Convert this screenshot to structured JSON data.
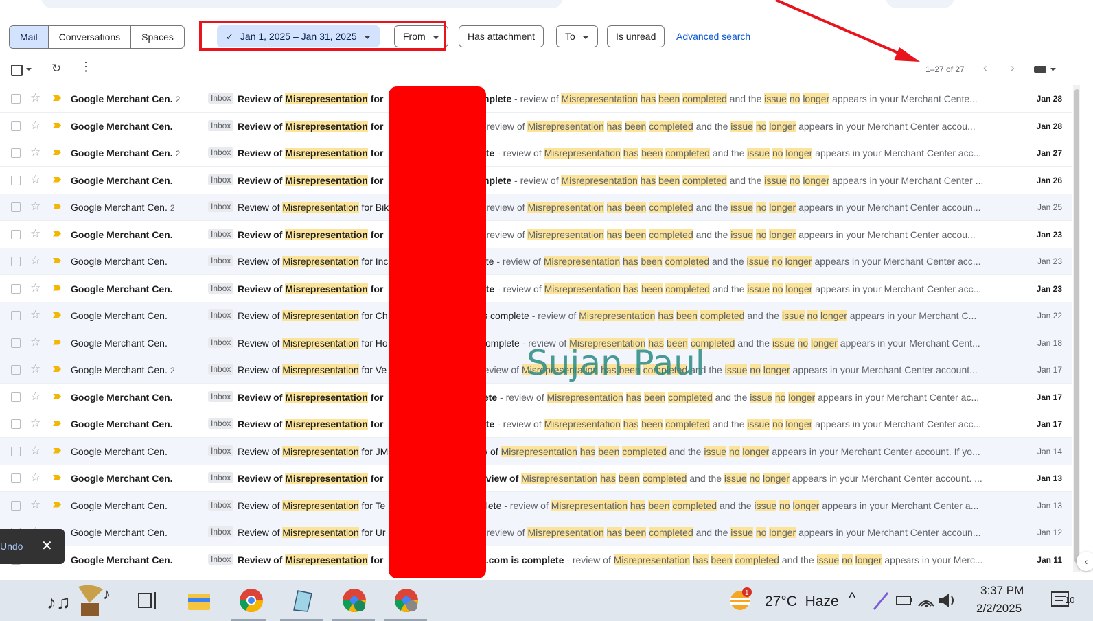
{
  "mode_tabs": [
    "Mail",
    "Conversations",
    "Spaces"
  ],
  "filters": {
    "date_range": "Jan 1, 2025 – Jan 31, 2025",
    "from": "From",
    "has_attachment": "Has attachment",
    "to": "To",
    "is_unread": "Is unread",
    "advanced_search": "Advanced search"
  },
  "pagination": {
    "count": "1–27 of 27"
  },
  "watermark": "Sujan Paul",
  "snackbar": {
    "undo": "Undo"
  },
  "highlight_terms": [
    "Misrepresentation",
    "has",
    "been",
    "completed",
    "issue",
    "no",
    "longer"
  ],
  "rows": [
    {
      "sender": "Google Merchant Cen.",
      "thread": "2",
      "tag": "Inbox",
      "subject": "Review of Misrepresentation for",
      "rest": "mplete",
      "snippet": " - review of Misrepresentation has been completed and the issue no longer appears in your Merchant Cente...",
      "date": "Jan 28",
      "unread": true
    },
    {
      "sender": "Google Merchant Cen.",
      "thread": "",
      "tag": "Inbox",
      "subject": "Review of Misrepresentation for",
      "rest": "",
      "snippet": " - review of Misrepresentation has been completed and the issue no longer appears in your Merchant Center accou...",
      "date": "Jan 28",
      "unread": true
    },
    {
      "sender": "Google Merchant Cen.",
      "thread": "2",
      "tag": "Inbox",
      "subject": "Review of Misrepresentation for",
      "rest": "ete",
      "snippet": " - review of Misrepresentation has been completed and the issue no longer appears in your Merchant Center acc...",
      "date": "Jan 27",
      "unread": true
    },
    {
      "sender": "Google Merchant Cen.",
      "thread": "",
      "tag": "Inbox",
      "subject": "Review of Misrepresentation for",
      "rest": "mplete",
      "snippet": " - review of Misrepresentation has been completed and the issue no longer appears in your Merchant Center ...",
      "date": "Jan 26",
      "unread": true
    },
    {
      "sender": "Google Merchant Cen.",
      "thread": "2",
      "tag": "Inbox",
      "subject": "Review of Misrepresentation for Bik",
      "rest": "",
      "snippet": " - review of Misrepresentation has been completed and the issue no longer appears in your Merchant Center accoun...",
      "date": "Jan 25",
      "unread": false
    },
    {
      "sender": "Google Merchant Cen.",
      "thread": "",
      "tag": "Inbox",
      "subject": "Review of Misrepresentation for",
      "rest": "",
      "snippet": " - review of Misrepresentation has been completed and the issue no longer appears in your Merchant Center accou...",
      "date": "Jan 23",
      "unread": true
    },
    {
      "sender": "Google Merchant Cen.",
      "thread": "",
      "tag": "Inbox",
      "subject": "Review of Misrepresentation for Inc",
      "rest": "ete",
      "snippet": " - review of Misrepresentation has been completed and the issue no longer appears in your Merchant Center acc...",
      "date": "Jan 23",
      "unread": false
    },
    {
      "sender": "Google Merchant Cen.",
      "thread": "",
      "tag": "Inbox",
      "subject": "Review of Misrepresentation for",
      "rest": "ete",
      "snippet": " - review of Misrepresentation has been completed and the issue no longer appears in your Merchant Center acc...",
      "date": "Jan 23",
      "unread": true
    },
    {
      "sender": "Google Merchant Cen.",
      "thread": "",
      "tag": "Inbox",
      "subject": "Review of Misrepresentation for Ch",
      "rest": "is complete",
      "snippet": " - review of Misrepresentation has been completed and the issue no longer appears in your Merchant C...",
      "date": "Jan 22",
      "unread": false
    },
    {
      "sender": "Google Merchant Cen.",
      "thread": "",
      "tag": "Inbox",
      "subject": "Review of Misrepresentation for Ho",
      "rest": "complete",
      "snippet": " - review of Misrepresentation has been completed and the issue no longer appears in your Merchant Cent...",
      "date": "Jan 18",
      "unread": false
    },
    {
      "sender": "Google Merchant Cen.",
      "thread": "2",
      "tag": "Inbox",
      "subject": "Review of Misrepresentation for Ve",
      "rest": "",
      "snippet": "review of Misrepresentation has been completed and the issue no longer appears in your Merchant Center account...",
      "date": "Jan 17",
      "unread": false
    },
    {
      "sender": "Google Merchant Cen.",
      "thread": "",
      "tag": "Inbox",
      "subject": "Review of Misrepresentation for",
      "rest": "lete",
      "snippet": " - review of Misrepresentation has been completed and the issue no longer appears in your Merchant Center ac...",
      "date": "Jan 17",
      "unread": true
    },
    {
      "sender": "Google Merchant Cen.",
      "thread": "",
      "tag": "Inbox",
      "subject": "Review of Misrepresentation for",
      "rest": "ete",
      "snippet": " - review of Misrepresentation has been completed and the issue no longer appears in your Merchant Center acc...",
      "date": "Jan 17",
      "unread": true
    },
    {
      "sender": "Google Merchant Cen.",
      "thread": "",
      "tag": "Inbox",
      "subject": "Review of Misrepresentation for JM",
      "rest": "w of",
      "snippet": " Misrepresentation has been completed and the issue no longer appears in your Merchant Center account. If yo...",
      "date": "Jan 14",
      "unread": false
    },
    {
      "sender": "Google Merchant Cen.",
      "thread": "",
      "tag": "Inbox",
      "subject": "Review of Misrepresentation for",
      "rest": "eview of",
      "snippet": " Misrepresentation has been completed and the issue no longer appears in your Merchant Center account. ...",
      "date": "Jan 13",
      "unread": true
    },
    {
      "sender": "Google Merchant Cen.",
      "thread": "",
      "tag": "Inbox",
      "subject": "Review of Misrepresentation for Te",
      "rest": "plete",
      "snippet": " - review of Misrepresentation has been completed and the issue no longer appears in your Merchant Center a...",
      "date": "Jan 13",
      "unread": false
    },
    {
      "sender": "Google Merchant Cen.",
      "thread": "",
      "tag": "Inbox",
      "subject": "Review of Misrepresentation for Ur",
      "rest": "",
      "snippet": " - review of Misrepresentation has been completed and the issue no longer appears in your Merchant Center accoun...",
      "date": "Jan 12",
      "unread": false
    },
    {
      "sender": "Google Merchant Cen.",
      "thread": "",
      "tag": "Inbox",
      "subject": "Review of Misrepresentation for",
      "rest": "s.com is complete",
      "snippet": " - review of Misrepresentation has been completed and the issue no longer appears in your Merc...",
      "date": "Jan 11",
      "unread": true
    }
  ],
  "taskbar": {
    "temperature": "27°C",
    "weather": "Haze",
    "weather_badge": "1",
    "time": "3:37 PM",
    "date": "2/2/2025",
    "notifications": "10"
  },
  "colors": {
    "highlight": "#fbe49a",
    "accent_link": "#0b57d0",
    "annotation_red": "#e8131b",
    "chip_selected": "#d3e3fd"
  }
}
